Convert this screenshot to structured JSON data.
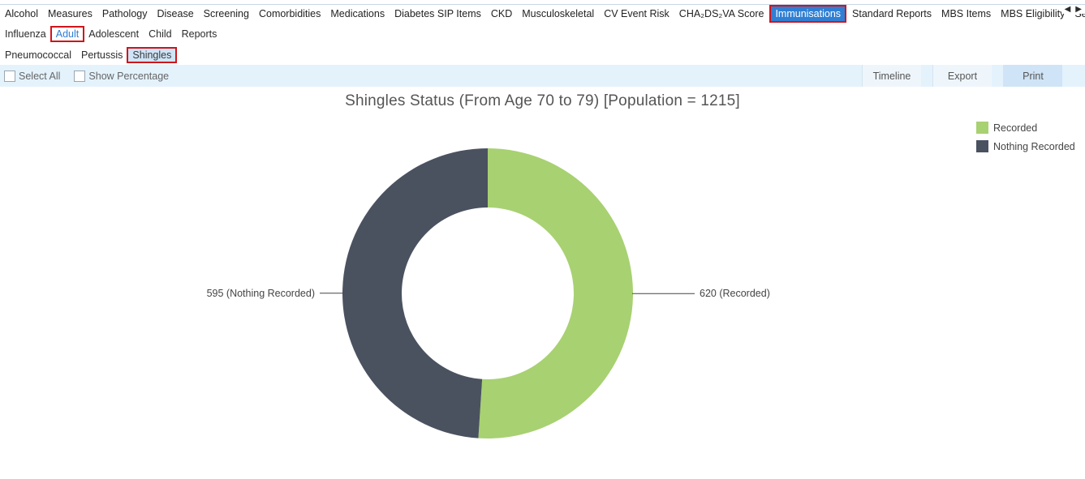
{
  "top_tabs": [
    {
      "label": "Alcohol"
    },
    {
      "label": "Measures"
    },
    {
      "label": "Pathology"
    },
    {
      "label": "Disease"
    },
    {
      "label": "Screening"
    },
    {
      "label": "Comorbidities"
    },
    {
      "label": "Medications"
    },
    {
      "label": "Diabetes SIP Items"
    },
    {
      "label": "CKD"
    },
    {
      "label": "Musculoskeletal"
    },
    {
      "label": "CV Event Risk"
    },
    {
      "label": "CHA₂DS₂VA Score"
    },
    {
      "label": "Immunisations",
      "active": true
    },
    {
      "label": "Standard Reports"
    },
    {
      "label": "MBS Items"
    },
    {
      "label": "MBS Eligibility"
    },
    {
      "label": "Sexual H"
    }
  ],
  "sub_tabs": [
    {
      "label": "Influenza"
    },
    {
      "label": "Adult",
      "selected": true
    },
    {
      "label": "Adolescent"
    },
    {
      "label": "Child"
    },
    {
      "label": "Reports"
    }
  ],
  "sub2_tabs": [
    {
      "label": "Pneumococcal"
    },
    {
      "label": "Pertussis"
    },
    {
      "label": "Shingles",
      "selected": true
    }
  ],
  "toolbar": {
    "select_all": "Select All",
    "show_percentage": "Show Percentage",
    "timeline": "Timeline",
    "export": "Export",
    "print": "Print"
  },
  "chart_data": {
    "type": "pie",
    "title": "Shingles Status (From Age 70 to 79) [Population = 1215]",
    "donut": true,
    "slices": [
      {
        "name": "Recorded",
        "value": 620,
        "label": "620 (Recorded)",
        "color": "#a8d172"
      },
      {
        "name": "Nothing Recorded",
        "value": 595,
        "label": "595 (Nothing Recorded)",
        "color": "#4a5260"
      }
    ],
    "legend_position": "top-right"
  }
}
